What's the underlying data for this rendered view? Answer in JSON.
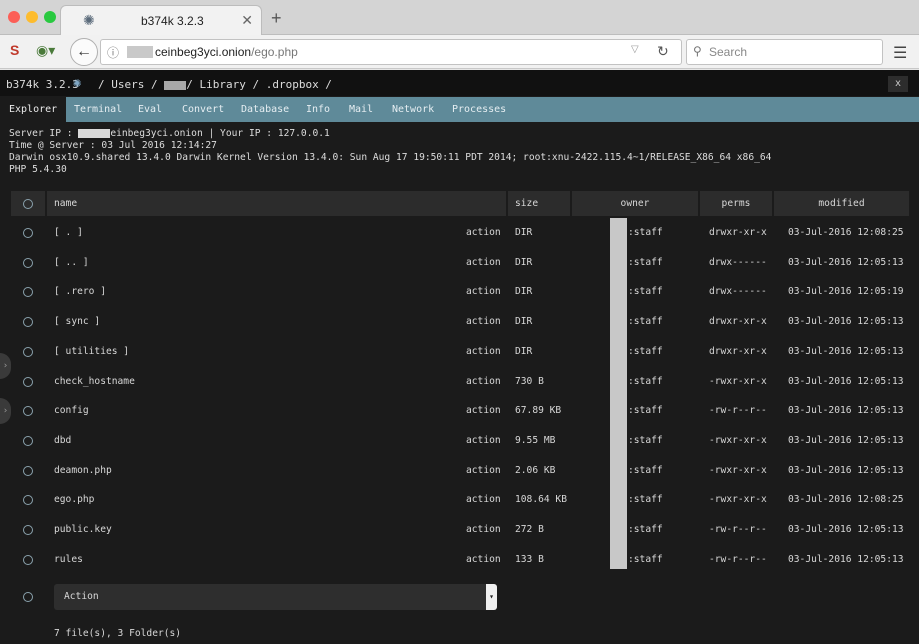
{
  "browser": {
    "tab_title": "b374k 3.2.3",
    "tab_close": "✕",
    "new_tab": "+",
    "url_domain": "ceinbeg3yci.onion",
    "url_path": "/ego.php",
    "search_placeholder": "Search"
  },
  "app": {
    "title": "b374k 3.2.3",
    "path_prefix": "/ Users /",
    "path_suffix": "/ Library / .dropbox /",
    "close_label": "x"
  },
  "menu": [
    {
      "label": "Explorer",
      "active": true
    },
    {
      "label": "Terminal"
    },
    {
      "label": "Eval"
    },
    {
      "label": "Convert"
    },
    {
      "label": "Database"
    },
    {
      "label": "Info"
    },
    {
      "label": "Mail"
    },
    {
      "label": "Network"
    },
    {
      "label": "Processes"
    }
  ],
  "server_info": {
    "server_ip_label": "Server IP : ",
    "server_ip_suffix": "einbeg3yci.onion",
    "your_ip": " | Your IP : 127.0.0.1",
    "time": "Time @ Server : 03 Jul 2016 12:14:27",
    "uname": "Darwin osx10.9.shared 13.4.0 Darwin Kernel Version 13.4.0: Sun Aug 17 19:50:11 PDT 2014; root:xnu-2422.115.4~1/RELEASE_X86_64 x86_64",
    "php": "PHP 5.4.30"
  },
  "table": {
    "headers": {
      "name": "name",
      "size": "size",
      "owner": "owner",
      "perms": "perms",
      "modified": "modified"
    },
    "rows": [
      {
        "name": "[ . ]",
        "action": "action",
        "size": "DIR",
        "owner": ":staff",
        "perms": "drwxr-xr-x",
        "modified": "03-Jul-2016 12:08:25"
      },
      {
        "name": "[ .. ]",
        "action": "action",
        "size": "DIR",
        "owner": ":staff",
        "perms": "drwx------",
        "modified": "03-Jul-2016 12:05:13"
      },
      {
        "name": "[ .rero ]",
        "action": "action",
        "size": "DIR",
        "owner": ":staff",
        "perms": "drwx------",
        "modified": "03-Jul-2016 12:05:19"
      },
      {
        "name": "[ sync ]",
        "action": "action",
        "size": "DIR",
        "owner": ":staff",
        "perms": "drwxr-xr-x",
        "modified": "03-Jul-2016 12:05:13"
      },
      {
        "name": "[ utilities ]",
        "action": "action",
        "size": "DIR",
        "owner": ":staff",
        "perms": "drwxr-xr-x",
        "modified": "03-Jul-2016 12:05:13"
      },
      {
        "name": "check_hostname",
        "action": "action",
        "size": "730 B",
        "owner": ":staff",
        "perms": "-rwxr-xr-x",
        "modified": "03-Jul-2016 12:05:13"
      },
      {
        "name": "config",
        "action": "action",
        "size": "67.89 KB",
        "owner": ":staff",
        "perms": "-rw-r--r--",
        "modified": "03-Jul-2016 12:05:13"
      },
      {
        "name": "dbd",
        "action": "action",
        "size": "9.55 MB",
        "owner": ":staff",
        "perms": "-rwxr-xr-x",
        "modified": "03-Jul-2016 12:05:13"
      },
      {
        "name": "deamon.php",
        "action": "action",
        "size": "2.06 KB",
        "owner": ":staff",
        "perms": "-rwxr-xr-x",
        "modified": "03-Jul-2016 12:05:13"
      },
      {
        "name": "ego.php",
        "action": "action",
        "size": "108.64 KB",
        "owner": ":staff",
        "perms": "-rwxr-xr-x",
        "modified": "03-Jul-2016 12:08:25"
      },
      {
        "name": "public.key",
        "action": "action",
        "size": "272 B",
        "owner": ":staff",
        "perms": "-rw-r--r--",
        "modified": "03-Jul-2016 12:05:13"
      },
      {
        "name": "rules",
        "action": "action",
        "size": "133 B",
        "owner": ":staff",
        "perms": "-rw-r--r--",
        "modified": "03-Jul-2016 12:05:13"
      }
    ],
    "action_select": "Action",
    "summary": "7 file(s), 3 Folder(s)"
  },
  "colors": {
    "menubar": "#5f8a99",
    "background": "#1b1b1b",
    "header_row": "#2c2c2c"
  }
}
